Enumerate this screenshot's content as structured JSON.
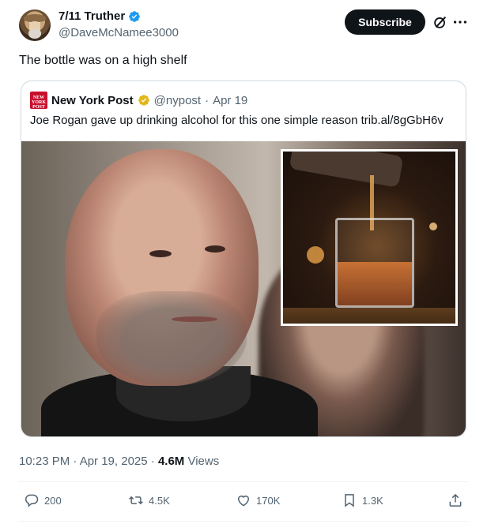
{
  "author": {
    "display_name": "7/11 Truther",
    "handle": "@DaveMcNamee3000",
    "verified_icon": "blue-check-icon"
  },
  "header": {
    "subscribe_label": "Subscribe",
    "grok_icon": "grok-icon",
    "more_icon": "more-icon"
  },
  "tweet": {
    "text": "The bottle was on a high shelf"
  },
  "quote": {
    "logo_text": "NEW YORK POST",
    "name": "New York Post",
    "handle": "@nypost",
    "separator": "·",
    "date": "Apr 19",
    "text": "Joe Rogan gave up drinking alcohol for this one simple reason trib.al/8gGbH6v",
    "verified_icon": "gold-check-icon"
  },
  "meta": {
    "time": "10:23 PM · Apr 19, 2025 · ",
    "views_count": "4.6M",
    "views_label": " Views"
  },
  "actions": {
    "replies": "200",
    "retweets": "4.5K",
    "likes": "170K",
    "bookmarks": "1.3K"
  },
  "colors": {
    "accent_blue": "#1d9bf0",
    "gold": "#e2b719",
    "text_primary": "#0f1419",
    "text_secondary": "#536471",
    "border": "#cfd9de",
    "nypost_red": "#c8102e"
  }
}
